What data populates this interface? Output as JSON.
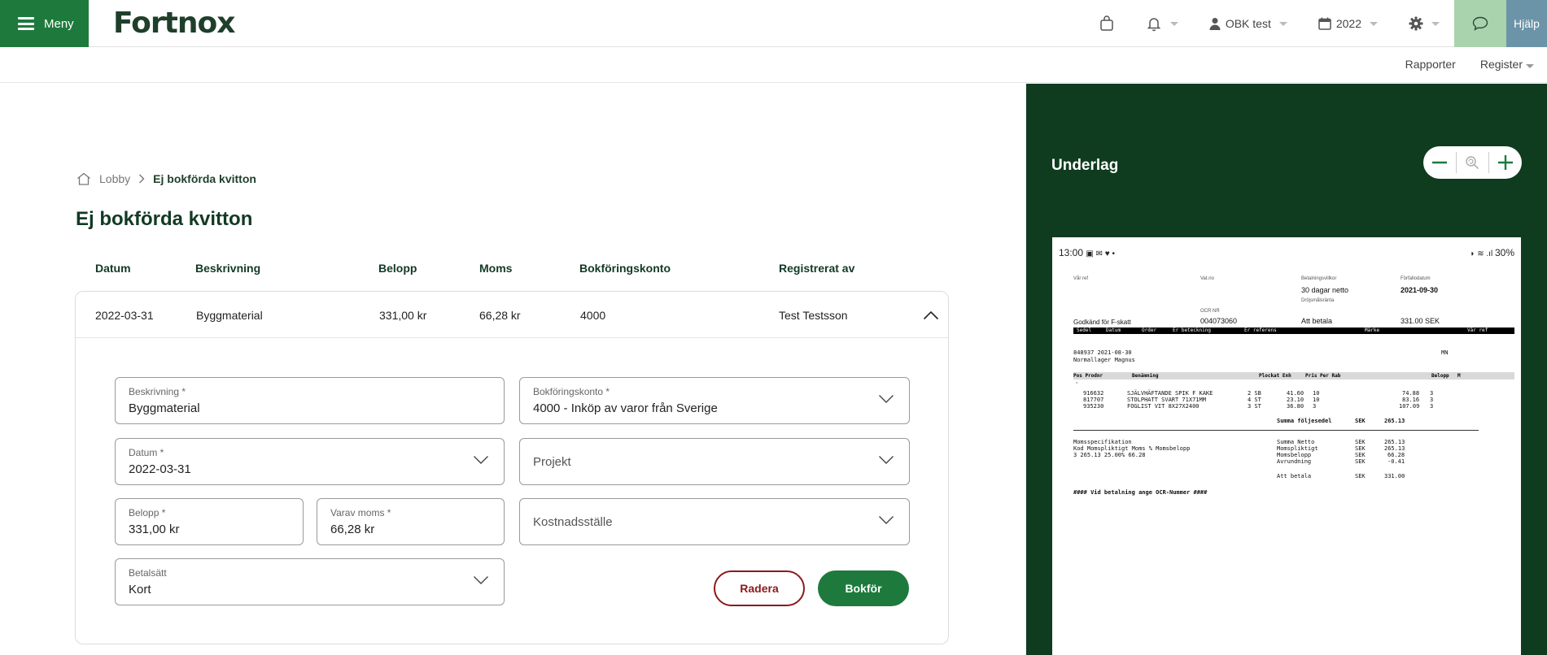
{
  "topbar": {
    "menu_label": "Meny",
    "logo_text": "Fortnox",
    "user_label": "OBK test",
    "year_label": "2022",
    "help_label": "Hjälp",
    "accent_color": "#1e7a3c"
  },
  "subbar": {
    "links": [
      "Rapporter",
      "Register"
    ]
  },
  "breadcrumb": {
    "home": "Lobby",
    "current": "Ej bokförda kvitton"
  },
  "page_title": "Ej bokförda kvitton",
  "table": {
    "headers": [
      "Datum",
      "Beskrivning",
      "Belopp",
      "Moms",
      "Bokföringskonto",
      "Registrerat av"
    ],
    "row": [
      "2022-03-31",
      "Byggmaterial",
      "331,00 kr",
      "66,28 kr",
      "4000",
      "Test Testsson"
    ]
  },
  "form": {
    "beskrivning": {
      "label": "Beskrivning *",
      "value": "Byggmaterial"
    },
    "bokforingskonto": {
      "label": "Bokföringskonto *",
      "value": "4000 - Inköp av varor från Sverige"
    },
    "datum": {
      "label": "Datum *",
      "value": "2022-03-31"
    },
    "projekt": {
      "placeholder": "Projekt"
    },
    "belopp": {
      "label": "Belopp *",
      "value": "331,00 kr"
    },
    "varav_moms": {
      "label": "Varav moms *",
      "value": "66,28 kr"
    },
    "kostnadsstalle": {
      "placeholder": "Kostnadsställe"
    },
    "betalsatt": {
      "label": "Betalsätt",
      "value": "Kort"
    },
    "delete_label": "Radera",
    "book_label": "Bokför"
  },
  "underlag": {
    "title": "Underlag",
    "receipt": {
      "status_left": "13:00",
      "status_right": "30%",
      "var_ref_label": "Vår ref",
      "vat_label": "Vat.no",
      "betalningsvillkor_label": "Betalningsvillkor",
      "betalningsvillkor": "30 dagar netto",
      "forfallodatum_label": "Förfallodatum",
      "forfallodatum": "2021-09-30",
      "drojsmal_label": "Dröjsmålsränta",
      "ocr_label": "OCR NR",
      "fskatt": "Godkänd för F-skatt",
      "ocr": "004073060",
      "att_betala_label": "Att betala",
      "att_betala": "331.00 SEK",
      "bar_cols": [
        "Sedel",
        "Datum",
        "Order",
        "Er beteckning",
        "Er referens",
        "Märke",
        "Vår ref"
      ],
      "order_line1": "848937   2021-08-30",
      "order_line1_r": "MN",
      "order_line2": "Normallager   Magnus",
      "item_cols": [
        "Pos Prodnr",
        "Benämning",
        "Plockat Enh",
        "Pris Per Rab",
        "Belopp",
        "M"
      ],
      "items": [
        [
          "916632",
          "SJÄLVHÄFTANDE SPIK F KAKE",
          "2 SB",
          "41.60",
          "10",
          "74.88",
          "3"
        ],
        [
          "817707",
          "STOLPHATT SVART 71X71MM",
          "4 ST",
          "23.10",
          "10",
          "83.16",
          "3"
        ],
        [
          "935230",
          "FOGLIST VIT 8X27X2400",
          "3 ST",
          "36.80",
          "3",
          "107.09",
          "3"
        ]
      ],
      "summa_foljesedel": "Summa följesedel",
      "summa_foljesedel_cur": "SEK",
      "summa_foljesedel_val": "265.13",
      "momsspec_title": "Momsspecifikation",
      "momsspec_cols": "Kod     Momspliktigt      Moms %   Momsbelopp",
      "momsspec_row": "3            265.13       25.00%        66.28",
      "totals": [
        [
          "Summa Netto",
          "SEK",
          "265.13"
        ],
        [
          "Momspliktigt",
          "SEK",
          "265.13"
        ],
        [
          "Momsbelopp",
          "SEK",
          "66.28"
        ],
        [
          "Avrundning",
          "SEK",
          "-0.41"
        ]
      ],
      "total_label": "Att betala",
      "total_cur": "SEK",
      "total_val": "331.00",
      "footer_note": "####  Vid betalning ange OCR-Nummer  ####"
    }
  }
}
